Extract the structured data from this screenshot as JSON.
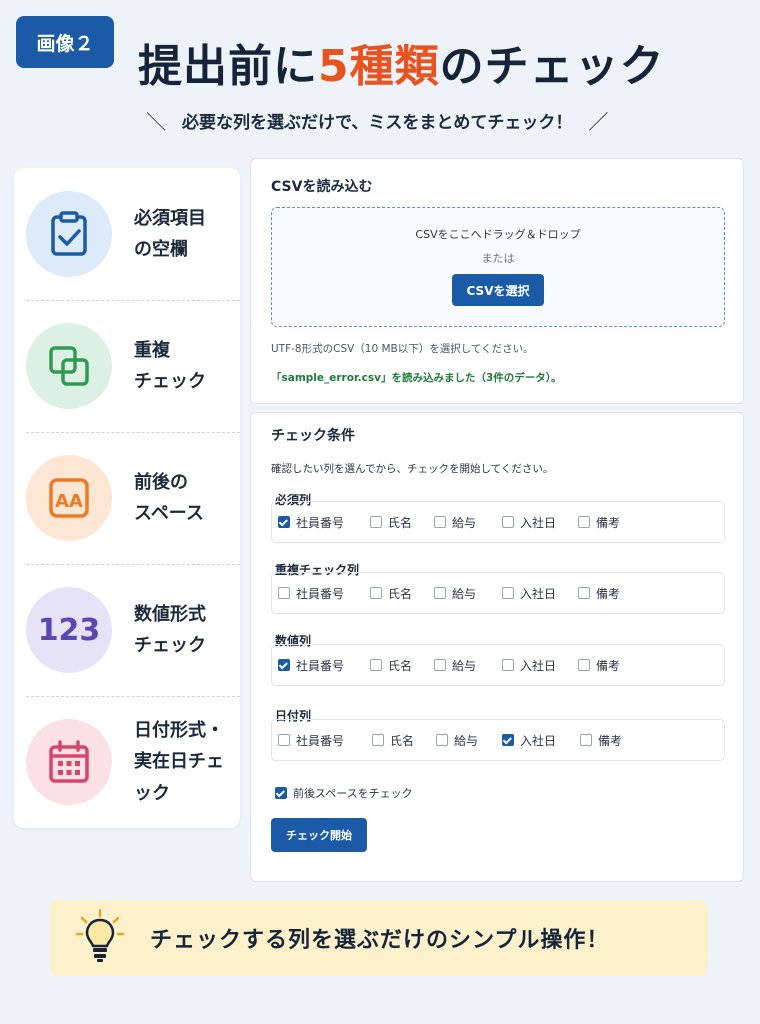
{
  "header": {
    "badge": "画像２",
    "title_part1": "提出前に",
    "title_accent": "5種類",
    "title_part2": "のチェック",
    "subtitle_left": "＼",
    "subtitle": "必要な列を選ぶだけで、ミスをまとめてチェック！",
    "subtitle_right": "／"
  },
  "features": [
    {
      "line1": "必須項目",
      "line2": "の空欄",
      "icon": "clipboard-check-icon"
    },
    {
      "line1": "重複",
      "line2": "チェック",
      "icon": "duplicate-squares-icon"
    },
    {
      "line1": "前後の",
      "line2": "スペース",
      "icon": "letters-aa-icon"
    },
    {
      "line1": "数値形式",
      "line2": "チェック",
      "icon": "number-123-icon",
      "icon_text": "123"
    },
    {
      "line1": "日付形式・",
      "line2": "実在日チェック",
      "icon": "calendar-icon"
    }
  ],
  "upload": {
    "title": "CSVを読み込む",
    "drop_text": "CSVをここへドラッグ＆ドロップ",
    "or_text": "または",
    "select_button": "CSVを選択",
    "note": "UTF-8形式のCSV（10 MB以下）を選択してください。",
    "status": "「sample_error.csv」を読み込みました（3件のデータ）。"
  },
  "conditions": {
    "title": "チェック条件",
    "description": "確認したい列を選んでから、チェックを開始してください。",
    "groups": [
      {
        "label": "必須列",
        "options": [
          {
            "label": "社員番号",
            "checked": true
          },
          {
            "label": "氏名",
            "checked": false
          },
          {
            "label": "給与",
            "checked": false
          },
          {
            "label": "入社日",
            "checked": false
          },
          {
            "label": "備考",
            "checked": false
          }
        ]
      },
      {
        "label": "重複チェック列",
        "options": [
          {
            "label": "社員番号",
            "checked": false
          },
          {
            "label": "氏名",
            "checked": false
          },
          {
            "label": "給与",
            "checked": false
          },
          {
            "label": "入社日",
            "checked": false
          },
          {
            "label": "備考",
            "checked": false
          }
        ]
      },
      {
        "label": "数値列",
        "options": [
          {
            "label": "社員番号",
            "checked": true
          },
          {
            "label": "氏名",
            "checked": false
          },
          {
            "label": "給与",
            "checked": false
          },
          {
            "label": "入社日",
            "checked": false
          },
          {
            "label": "備考",
            "checked": false
          }
        ]
      },
      {
        "label": "日付列",
        "options": [
          {
            "label": "社員番号",
            "checked": false
          },
          {
            "label": "氏名",
            "checked": false
          },
          {
            "label": "給与",
            "checked": false
          },
          {
            "label": "入社日",
            "checked": true
          },
          {
            "label": "備考",
            "checked": false
          }
        ]
      }
    ],
    "trim_label": "前後スペースをチェック",
    "trim_checked": true,
    "start_button": "チェック開始"
  },
  "footer": {
    "message": "チェックする列を選ぶだけのシンプル操作！",
    "icon": "lightbulb-icon"
  },
  "colors": {
    "primary": "#1b5aa6",
    "accent": "#e8531f",
    "success": "#1f7a3a",
    "footer_bg": "#fdf1cb"
  }
}
